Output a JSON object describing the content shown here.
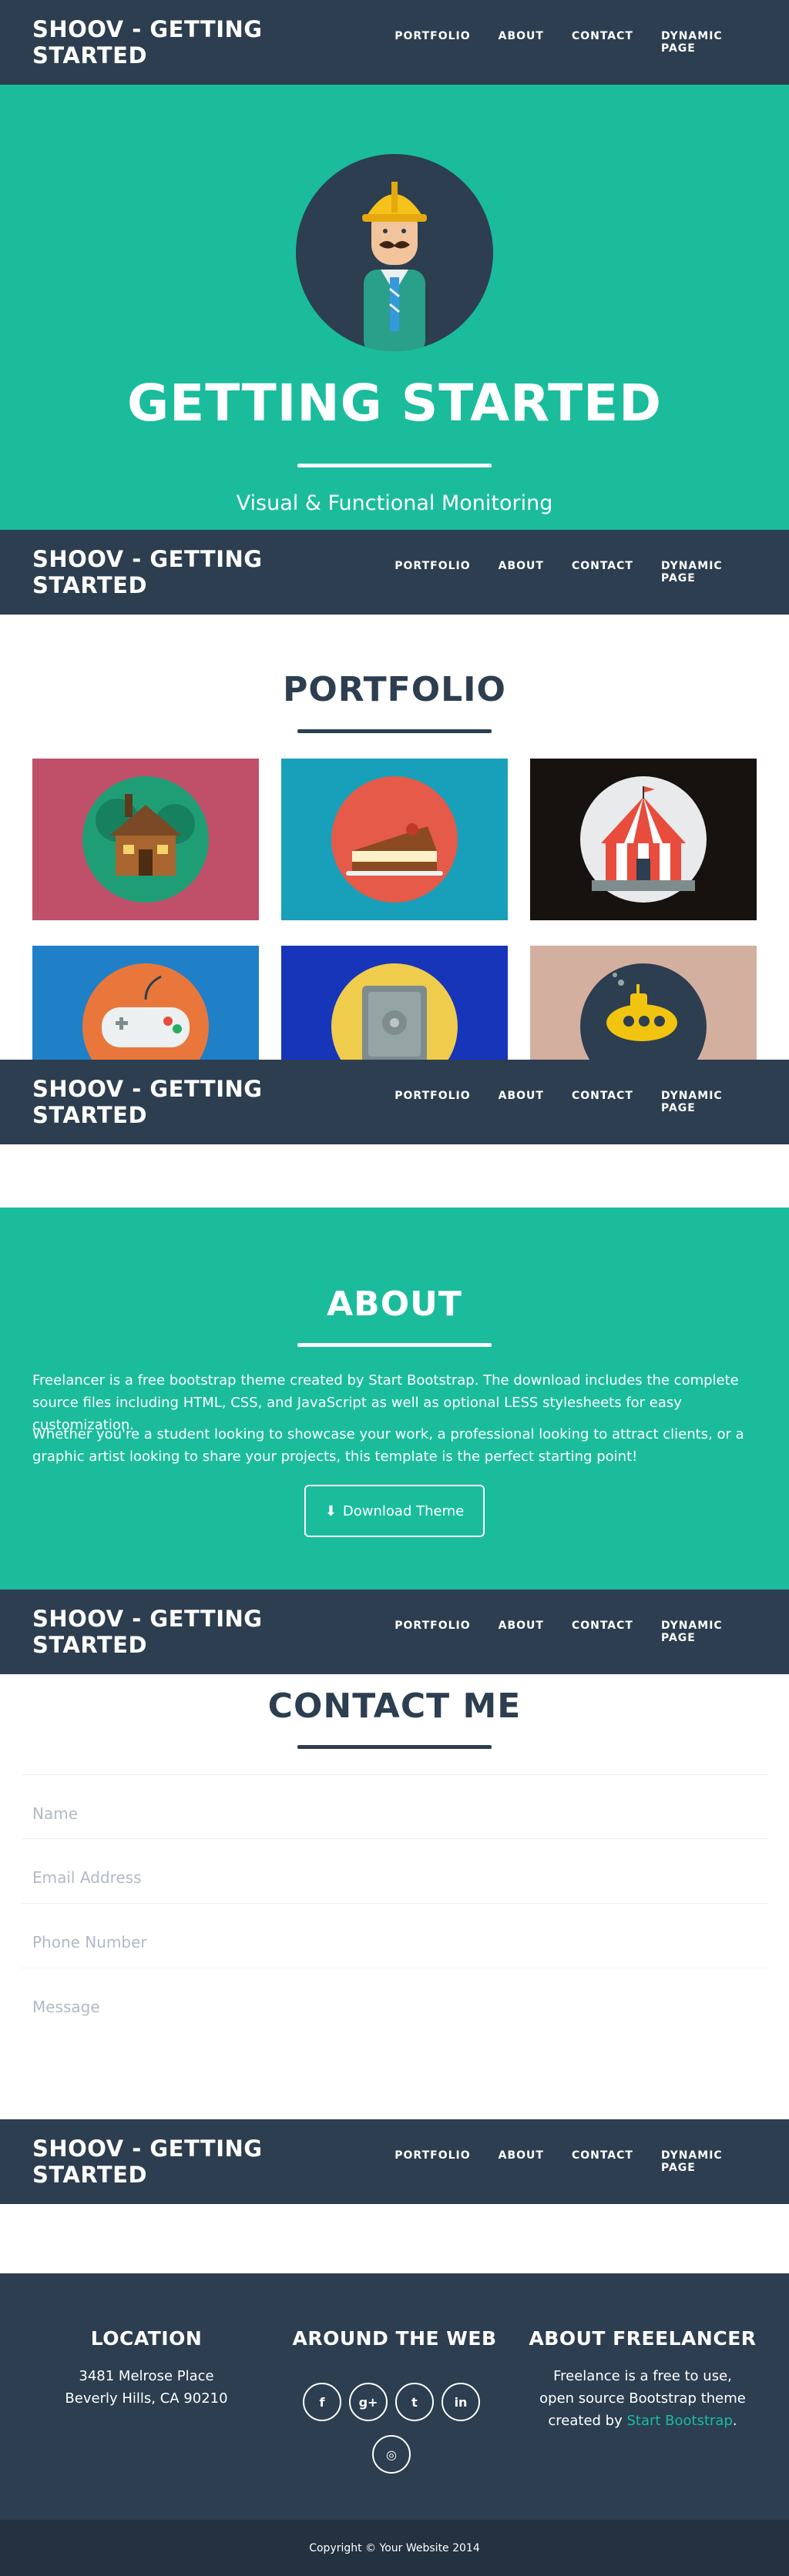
{
  "navbar": {
    "brand": "SHOOV - GETTING STARTED",
    "links": [
      "PORTFOLIO",
      "ABOUT",
      "CONTACT",
      "DYNAMIC PAGE"
    ]
  },
  "hero": {
    "title": "GETTING STARTED",
    "subtitle": "Visual & Functional Monitoring"
  },
  "portfolio": {
    "title": "PORTFOLIO",
    "items": [
      {
        "name": "cabin",
        "bg": "#c0506a",
        "circle": "#1f9e76"
      },
      {
        "name": "cake",
        "bg": "#18a0bb",
        "circle": "#e55a48"
      },
      {
        "name": "circus",
        "bg": "#17120f",
        "circle": "#e9eaec"
      },
      {
        "name": "game",
        "bg": "#1f80c8",
        "circle": "#e9773b"
      },
      {
        "name": "safe",
        "bg": "#1735b9",
        "circle": "#f0cc4d"
      },
      {
        "name": "submarine",
        "bg": "#d3afa0",
        "circle": "#2c3e50"
      }
    ]
  },
  "about": {
    "title": "ABOUT",
    "p1": "Freelancer is a free bootstrap theme created by Start Bootstrap. The download includes the complete source files including HTML, CSS, and JavaScript as well as optional LESS stylesheets for easy customization.",
    "p2": "Whether you're a student looking to showcase your work, a professional looking to attract clients, or a graphic artist looking to share your projects, this template is the perfect starting point!",
    "button": "Download Theme"
  },
  "contact": {
    "title": "CONTACT ME",
    "fields": [
      {
        "placeholder": "Name"
      },
      {
        "placeholder": "Email Address"
      },
      {
        "placeholder": "Phone Number"
      },
      {
        "placeholder": "Message"
      }
    ]
  },
  "footer": {
    "location": {
      "title": "LOCATION",
      "line1": "3481 Melrose Place",
      "line2": "Beverly Hills, CA 90210"
    },
    "web": {
      "title": "AROUND THE WEB",
      "icons": [
        "f",
        "g+",
        "t",
        "in",
        "dribbble"
      ]
    },
    "freelancer": {
      "title": "ABOUT FREELANCER",
      "text_before": "Freelance is a free to use, open source Bootstrap theme created by ",
      "link": "Start Bootstrap",
      "text_after": "."
    },
    "copyright": "Copyright © Your Website 2014"
  },
  "colors": {
    "primary": "#2c3e50",
    "accent": "#1abc9c"
  }
}
